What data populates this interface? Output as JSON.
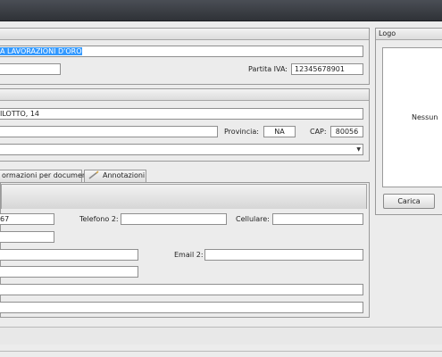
{
  "company_group": {
    "name_value": "A LAVORAZIONI D'ORO",
    "code_value": "",
    "vat_label": "Partita IVA:",
    "vat_value": "12345678901"
  },
  "address_group": {
    "street_value": "ILOTTO, 14",
    "city_value": "",
    "province_label": "Provincia:",
    "province_value": "NA",
    "cap_label": "CAP:",
    "cap_value": "80056",
    "country_value": ""
  },
  "tabs": [
    {
      "label": "ormazioni per documenti",
      "icon": "document-icon"
    },
    {
      "label": "Annotazioni",
      "icon": "pencil-icon"
    }
  ],
  "contacts": {
    "phone1_value": "67",
    "phone2_label": "Telefono 2:",
    "phone2_value": "",
    "mobile_label": "Cellulare:",
    "mobile_value": "",
    "fax_value": "",
    "email1_value": "",
    "email2_label": "Email 2:",
    "email2_value": "",
    "pec_value": "",
    "website_value": "",
    "notes_value": ""
  },
  "logo": {
    "title": "Logo",
    "placeholder": "Nessun",
    "load_button": "Carica"
  },
  "colors": {
    "titlebar": "#3a3d43",
    "selection": "#3399ff"
  }
}
